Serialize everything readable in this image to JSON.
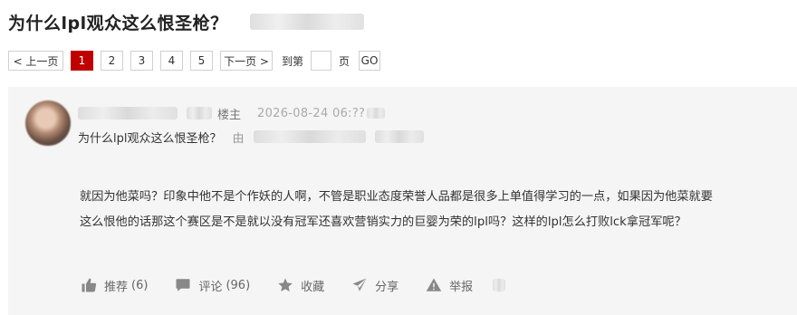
{
  "thread": {
    "title": "为什么lpl观众这么恨圣枪？"
  },
  "pager": {
    "prev": "< 上一页",
    "pages": [
      "1",
      "2",
      "3",
      "4",
      "5"
    ],
    "active_page": "1",
    "next": "下一页 >",
    "goto_prefix": "到第",
    "goto_suffix": "页",
    "go": "GO"
  },
  "post": {
    "owner_tag": "楼主",
    "date": "2026-08-24 06:??",
    "subject": "为什么lpl观众这么恨圣枪？",
    "by_label": "由",
    "content": [
      "就因为他菜吗？印象中他不是个作妖的人啊，不管是职业态度荣誉人品都是很多上单值得学习的一点，如果因为他菜就要",
      "这么恨他的话那这个赛区是不是就以没有冠军还喜欢营销实力的巨婴为荣的lpl吗？这样的lpl怎么打败lck拿冠军呢？"
    ],
    "actions": {
      "recommend_label": "推荐",
      "recommend_count": "(6)",
      "comment_label": "评论",
      "comment_count": "(96)",
      "favorite_label": "收藏",
      "share_label": "分享",
      "report_label": "举报"
    }
  },
  "icons": {
    "recommend": "thumbs-up-icon",
    "comment": "comment-icon",
    "favorite": "star-icon",
    "share": "share-icon",
    "report": "warning-icon"
  },
  "colors": {
    "active_page": "#c00000",
    "post_bg": "#f5f5f5"
  }
}
